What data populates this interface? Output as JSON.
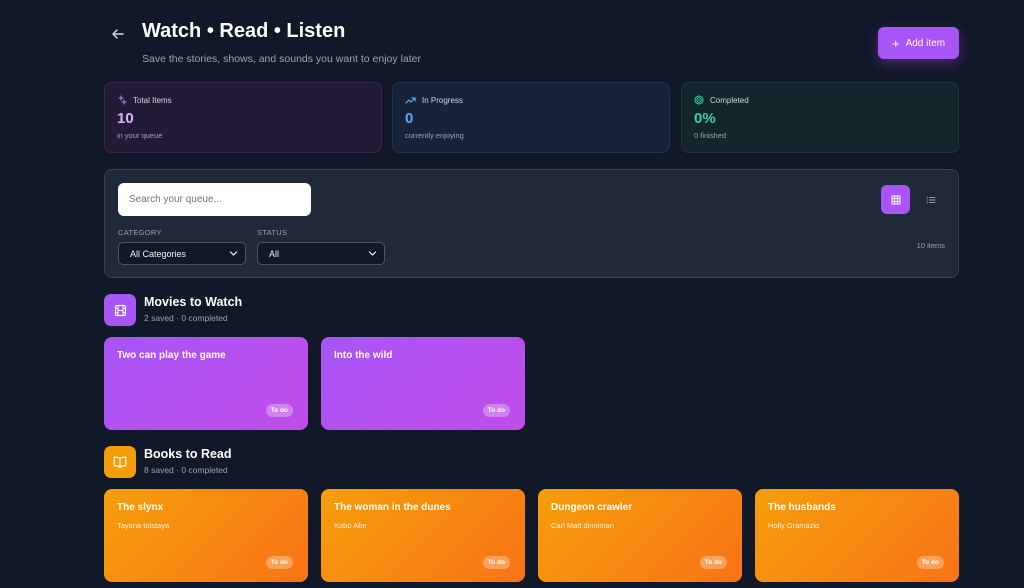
{
  "header": {
    "title": "Watch • Read • Listen",
    "subtitle": "Save the stories, shows, and sounds you want to enjoy later",
    "add_button": "Add item"
  },
  "stats": {
    "total": {
      "label": "Total Items",
      "value": "10",
      "sub": "in your queue"
    },
    "progress": {
      "label": "In Progress",
      "value": "0",
      "sub": "currently enjoying"
    },
    "completed": {
      "label": "Completed",
      "value": "0%",
      "sub": "0 finished"
    }
  },
  "filters": {
    "search_placeholder": "Search your queue...",
    "category_label": "CATEGORY",
    "category_value": "All Categories",
    "status_label": "STATUS",
    "status_value": "All",
    "item_count": "10 items"
  },
  "movies": {
    "title": "Movies to Watch",
    "sub": "2 saved · 0 completed",
    "items": [
      {
        "title": "Two can play the game",
        "status": "To do"
      },
      {
        "title": "Into the wild",
        "status": "To do"
      }
    ]
  },
  "books": {
    "title": "Books to Read",
    "sub": "8 saved · 0 completed",
    "items": [
      {
        "title": "The slynx",
        "author": "Tayana tolstaya",
        "status": "To do"
      },
      {
        "title": "The woman in the dunes",
        "author": "Kobo Abe",
        "status": "To do"
      },
      {
        "title": "Dungeon crawler",
        "author": "Carl Matt dinniman",
        "status": "To do"
      },
      {
        "title": "The husbands",
        "author": "Holly Gramazio",
        "status": "To do"
      }
    ]
  },
  "colors": {
    "background": "#111827",
    "accent": "#a855f7",
    "books_accent": "#f59e0b",
    "progress_blue": "#60a5fa",
    "completed_green": "#34d399"
  },
  "icons": {
    "back": "arrow-left-icon",
    "add": "plus-icon",
    "total": "sparkles-icon",
    "progress": "trending-up-icon",
    "completed": "target-icon",
    "grid_view": "grid-icon",
    "list_view": "list-icon",
    "movies": "film-icon",
    "books": "book-open-icon"
  }
}
